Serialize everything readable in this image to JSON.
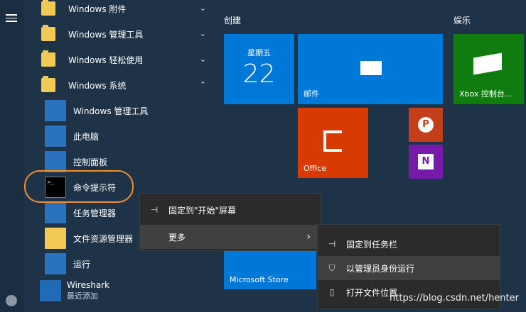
{
  "sections": {
    "create": "创建",
    "entertainment": "娱乐"
  },
  "folders": [
    {
      "label": "Windows 附件"
    },
    {
      "label": "Windows 管理工具"
    },
    {
      "label": "Windows 轻松使用"
    },
    {
      "label": "Windows 系统"
    }
  ],
  "system_items": [
    {
      "label": "Windows 管理工具"
    },
    {
      "label": "此电脑"
    },
    {
      "label": "控制面板"
    },
    {
      "label": "命令提示符"
    },
    {
      "label": "任务管理器"
    },
    {
      "label": "文件资源管理器"
    },
    {
      "label": "运行"
    }
  ],
  "wireshark": {
    "label": "Wireshark",
    "sub": "最近添加"
  },
  "tiles": {
    "calendar": {
      "day": "星期五",
      "date": "22"
    },
    "mail": {
      "label": "邮件"
    },
    "xbox": {
      "label": "Xbox 控制台..."
    },
    "office": {
      "label": "Office"
    },
    "store": {
      "label": "Microsoft Store"
    }
  },
  "context_menu": {
    "pin_start": "固定到\"开始\"屏幕",
    "more": "更多"
  },
  "submenu": {
    "pin_taskbar": "固定到任务栏",
    "run_admin": "以管理员身份运行",
    "open_location": "打开文件位置"
  },
  "watermark": "https://blog.csdn.net/henter"
}
